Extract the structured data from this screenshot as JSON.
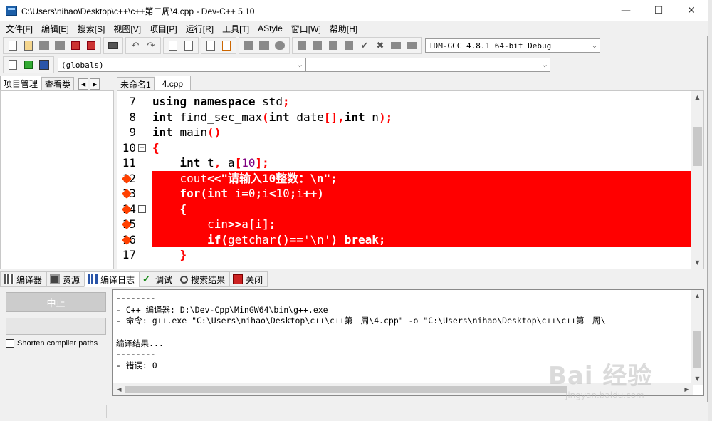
{
  "window": {
    "title": "C:\\Users\\nihao\\Desktop\\c++\\c++第二周\\4.cpp - Dev-C++ 5.10",
    "controls": [
      "—",
      "☐",
      "✕"
    ]
  },
  "menu": [
    "文件[F]",
    "编辑[E]",
    "搜索[S]",
    "视图[V]",
    "项目[P]",
    "运行[R]",
    "工具[T]",
    "AStyle",
    "窗口[W]",
    "帮助[H]"
  ],
  "toolbar": {
    "compiler_select": "TDM-GCC 4.8.1 64-bit Debug",
    "scope_select": "(globals)",
    "symbol_select": ""
  },
  "left_tabs": [
    "项目管理",
    "查看类"
  ],
  "editor_tabs": [
    "未命名1",
    "4.cpp"
  ],
  "code_lines": [
    {
      "num": "7",
      "tokens": [
        {
          "t": "using",
          "c": "kw"
        },
        {
          "t": " "
        },
        {
          "t": "namespace",
          "c": "kw"
        },
        {
          "t": " std"
        },
        {
          "t": ";",
          "c": "sym"
        }
      ]
    },
    {
      "num": "8",
      "tokens": [
        {
          "t": "int",
          "c": "kw"
        },
        {
          "t": " find_sec_max"
        },
        {
          "t": "(",
          "c": "sym"
        },
        {
          "t": "int",
          "c": "kw"
        },
        {
          "t": " date"
        },
        {
          "t": "[],",
          "c": "sym"
        },
        {
          "t": "int",
          "c": "kw"
        },
        {
          "t": " n"
        },
        {
          "t": ");",
          "c": "sym"
        }
      ]
    },
    {
      "num": "9",
      "tokens": [
        {
          "t": "int",
          "c": "kw"
        },
        {
          "t": " main"
        },
        {
          "t": "()",
          "c": "sym"
        }
      ]
    },
    {
      "num": "10",
      "tokens": [
        {
          "t": "{",
          "c": "sym"
        }
      ]
    },
    {
      "num": "11",
      "tokens": [
        {
          "t": "    "
        },
        {
          "t": "int",
          "c": "kw"
        },
        {
          "t": " t"
        },
        {
          "t": ",",
          "c": "sym"
        },
        {
          "t": " a"
        },
        {
          "t": "[",
          "c": "sym"
        },
        {
          "t": "10",
          "c": "num"
        },
        {
          "t": "];",
          "c": "sym"
        }
      ]
    },
    {
      "num": "12",
      "tokens": [
        {
          "t": "    cout"
        },
        {
          "t": "<<",
          "c": "sym"
        },
        {
          "t": "\"请输入10整数：\\n\"",
          "c": "kw"
        },
        {
          "t": ";",
          "c": "sym"
        }
      ]
    },
    {
      "num": "13",
      "tokens": [
        {
          "t": "    "
        },
        {
          "t": "for",
          "c": "kw"
        },
        {
          "t": "(",
          "c": "sym"
        },
        {
          "t": "int",
          "c": "kw"
        },
        {
          "t": " i"
        },
        {
          "t": "=",
          "c": "sym"
        },
        {
          "t": "0"
        },
        {
          "t": ";",
          "c": "sym"
        },
        {
          "t": "i"
        },
        {
          "t": "<",
          "c": "sym"
        },
        {
          "t": "10"
        },
        {
          "t": ";",
          "c": "sym"
        },
        {
          "t": "i"
        },
        {
          "t": "++)",
          "c": "sym"
        }
      ]
    },
    {
      "num": "14",
      "tokens": [
        {
          "t": "    "
        },
        {
          "t": "{",
          "c": "sym"
        }
      ]
    },
    {
      "num": "15",
      "tokens": [
        {
          "t": "        cin"
        },
        {
          "t": ">>",
          "c": "sym"
        },
        {
          "t": "a"
        },
        {
          "t": "[",
          "c": "sym"
        },
        {
          "t": "i"
        },
        {
          "t": "];",
          "c": "sym"
        }
      ]
    },
    {
      "num": "16",
      "tokens": [
        {
          "t": "        "
        },
        {
          "t": "if",
          "c": "kw"
        },
        {
          "t": "(",
          "c": "sym"
        },
        {
          "t": "getchar"
        },
        {
          "t": "()==",
          "c": "sym"
        },
        {
          "t": "'\\n'"
        },
        {
          "t": ")",
          "c": "sym"
        },
        {
          "t": " "
        },
        {
          "t": "break",
          "c": "kw"
        },
        {
          "t": ";",
          "c": "sym"
        }
      ]
    },
    {
      "num": "17",
      "tokens": [
        {
          "t": "    "
        },
        {
          "t": "}",
          "c": "sym"
        }
      ]
    }
  ],
  "bottom_tabs": [
    {
      "label": "编译器",
      "icon": "compiler-grid-icon"
    },
    {
      "label": "资源",
      "icon": "resources-icon"
    },
    {
      "label": "编译日志",
      "icon": "compile-log-icon"
    },
    {
      "label": "调试",
      "icon": "debug-check-icon"
    },
    {
      "label": "搜索结果",
      "icon": "search-results-icon"
    },
    {
      "label": "关闭",
      "icon": "close-icon"
    }
  ],
  "compile_panel": {
    "stop_label": "中止",
    "progress": 0,
    "shorten_label": "Shorten compiler paths",
    "shorten_checked": false
  },
  "log_lines": [
    "--------",
    "- C++ 编译器: D:\\Dev-Cpp\\MinGW64\\bin\\g++.exe",
    "- 命令: g++.exe \"C:\\Users\\nihao\\Desktop\\c++\\c++第二周\\4.cpp\" -o \"C:\\Users\\nihao\\Desktop\\c++\\c++第二周\\",
    "",
    "编译结果...",
    "--------",
    "- 错误: 0"
  ],
  "watermark": {
    "text": "Bai 经验",
    "sub": "jingyan.baidu.com"
  },
  "colors": {
    "highlight": "#ff0000",
    "keyword_sym": "#ff0000",
    "number": "#800080"
  }
}
